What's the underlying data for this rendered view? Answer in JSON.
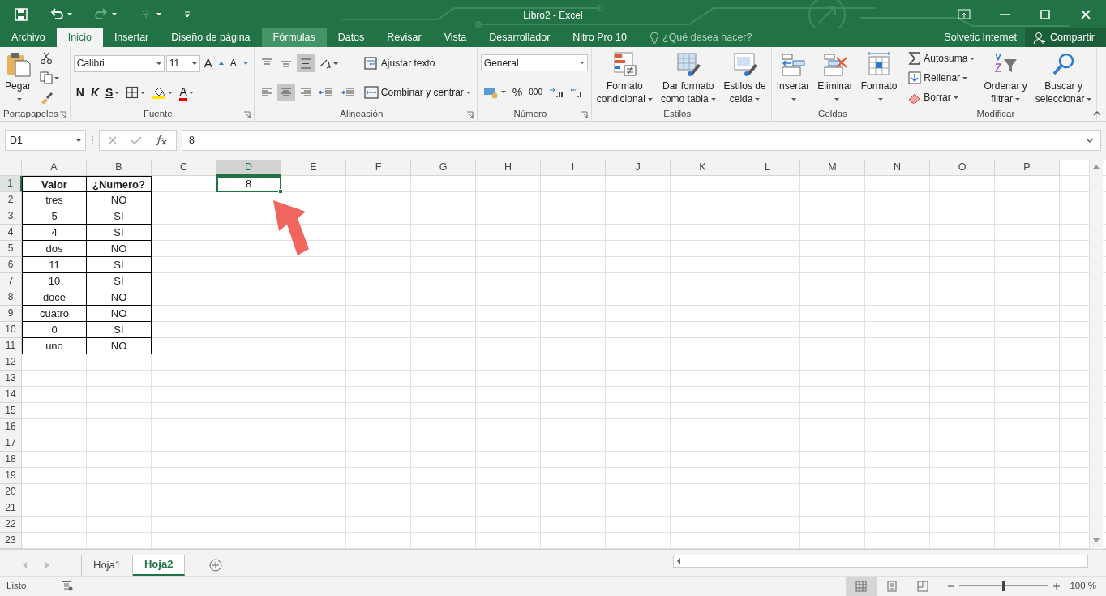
{
  "window": {
    "title": "Libro2 - Excel"
  },
  "tabs": [
    {
      "label": "Archivo",
      "selected": false,
      "highlighted": false
    },
    {
      "label": "Inicio",
      "selected": true,
      "highlighted": false
    },
    {
      "label": "Insertar",
      "selected": false,
      "highlighted": false
    },
    {
      "label": "Diseño de página",
      "selected": false,
      "highlighted": false
    },
    {
      "label": "Fórmulas",
      "selected": false,
      "highlighted": true
    },
    {
      "label": "Datos",
      "selected": false,
      "highlighted": false
    },
    {
      "label": "Revisar",
      "selected": false,
      "highlighted": false
    },
    {
      "label": "Vista",
      "selected": false,
      "highlighted": false
    },
    {
      "label": "Desarrollador",
      "selected": false,
      "highlighted": false
    },
    {
      "label": "Nitro Pro 10",
      "selected": false,
      "highlighted": false
    }
  ],
  "tell_me": {
    "placeholder": "¿Qué desea hacer?"
  },
  "account": {
    "user": "Solvetic Internet",
    "share": "Compartir"
  },
  "ribbon": [
    {
      "label": "Portapapeles",
      "launcher": true,
      "columns": [
        [
          [
            {
              "kind": "large",
              "lines": [
                "Pegar"
              ],
              "dropdown": true
            }
          ]
        ],
        [
          [
            {
              "kind": "icon",
              "dropdown": false
            }
          ],
          [
            {
              "kind": "icon",
              "dropdown": true
            }
          ],
          [
            {
              "kind": "icon",
              "dropdown": false
            }
          ]
        ]
      ]
    },
    {
      "label": "Fuente",
      "launcher": true,
      "columns": [
        [
          [
            {
              "kind": "field",
              "value": "Calibri"
            },
            {
              "kind": "field",
              "value": "11"
            },
            {
              "kind": "grow",
              "label": "A",
              "dropdown": false
            },
            {
              "kind": "shrink",
              "label": "A",
              "dropdown": false
            }
          ],
          [
            {
              "kind": "bold",
              "label": "N",
              "dropdown": false
            },
            {
              "kind": "italic",
              "label": "K",
              "dropdown": false
            },
            {
              "kind": "underline",
              "label": "S",
              "dropdown": true
            },
            {
              "kind": "icon",
              "dropdown": true
            },
            {
              "kind": "icon",
              "dropdown": true
            },
            {
              "kind": "color",
              "label": "A",
              "dropdown": true
            }
          ]
        ]
      ]
    },
    {
      "label": "Alineación",
      "launcher": true,
      "columns": [
        [
          [
            {
              "kind": "icon",
              "dropdown": false,
              "pressed": false
            },
            {
              "kind": "icon",
              "dropdown": false,
              "pressed": false
            },
            {
              "kind": "icon",
              "dropdown": false,
              "pressed": true
            },
            {
              "kind": "icon",
              "dropdown": true,
              "pressed": false
            }
          ],
          [
            {
              "kind": "icon",
              "dropdown": false,
              "pressed": false
            },
            {
              "kind": "icon",
              "dropdown": false,
              "pressed": true
            },
            {
              "kind": "icon",
              "dropdown": false,
              "pressed": false
            },
            {
              "kind": "icon",
              "dropdown": false,
              "pressed": false
            },
            {
              "kind": "icon",
              "dropdown": false,
              "pressed": false
            }
          ]
        ],
        [
          [
            {
              "kind": "small",
              "label": "Ajustar texto",
              "dropdown": false
            }
          ],
          [
            {
              "kind": "small",
              "label": "Combinar y centrar",
              "dropdown": true
            }
          ]
        ]
      ]
    },
    {
      "label": "Número",
      "launcher": true,
      "columns": [
        [
          [
            {
              "kind": "field",
              "value": "General"
            }
          ],
          [
            {
              "kind": "icon",
              "dropdown": true
            },
            {
              "kind": "glyph",
              "label": "%",
              "dropdown": false
            },
            {
              "kind": "small-glyph",
              "label": "000",
              "dropdown": false
            },
            {
              "kind": "icon",
              "dropdown": false
            },
            {
              "kind": "icon",
              "dropdown": false
            }
          ]
        ]
      ]
    },
    {
      "label": "Estilos",
      "launcher": false,
      "columns": [
        [
          [
            {
              "kind": "large",
              "lines": [
                "Formato",
                "condicional"
              ],
              "dropdown": true
            }
          ]
        ],
        [
          [
            {
              "kind": "large",
              "lines": [
                "Dar formato",
                "como tabla"
              ],
              "dropdown": true
            }
          ]
        ],
        [
          [
            {
              "kind": "large",
              "lines": [
                "Estilos de",
                "celda"
              ],
              "dropdown": true
            }
          ]
        ]
      ]
    },
    {
      "label": "Celdas",
      "launcher": false,
      "columns": [
        [
          [
            {
              "kind": "large",
              "lines": [
                "Insertar"
              ],
              "dropdown": true
            }
          ]
        ],
        [
          [
            {
              "kind": "large",
              "lines": [
                "Eliminar"
              ],
              "dropdown": true
            }
          ]
        ],
        [
          [
            {
              "kind": "large",
              "lines": [
                "Formato"
              ],
              "dropdown": true
            }
          ]
        ]
      ]
    },
    {
      "label": "Modificar",
      "launcher": false,
      "columns": [
        [
          [
            {
              "kind": "small",
              "label": "Autosuma",
              "dropdown": true
            }
          ],
          [
            {
              "kind": "small",
              "label": "Rellenar",
              "dropdown": true
            }
          ],
          [
            {
              "kind": "small",
              "label": "Borrar",
              "dropdown": true
            }
          ]
        ],
        [
          [
            {
              "kind": "large",
              "lines": [
                "Ordenar y",
                "filtrar"
              ],
              "dropdown": true
            }
          ]
        ],
        [
          [
            {
              "kind": "large",
              "lines": [
                "Buscar y",
                "seleccionar"
              ],
              "dropdown": true
            }
          ]
        ]
      ]
    }
  ],
  "formula_bar": {
    "name_box": "D1",
    "value": "8"
  },
  "active_cell": {
    "value": "8"
  },
  "columns": [
    {
      "label": "A",
      "selected": false
    },
    {
      "label": "B",
      "selected": false
    },
    {
      "label": "C",
      "selected": false
    },
    {
      "label": "D",
      "selected": true
    },
    {
      "label": "E",
      "selected": false
    },
    {
      "label": "F",
      "selected": false
    },
    {
      "label": "G",
      "selected": false
    },
    {
      "label": "H",
      "selected": false
    },
    {
      "label": "I",
      "selected": false
    },
    {
      "label": "J",
      "selected": false
    },
    {
      "label": "K",
      "selected": false
    },
    {
      "label": "L",
      "selected": false
    },
    {
      "label": "M",
      "selected": false
    },
    {
      "label": "N",
      "selected": false
    },
    {
      "label": "O",
      "selected": false
    },
    {
      "label": "P",
      "selected": false
    }
  ],
  "rows": [
    {
      "label": "1",
      "selected": true,
      "cells": [
        {
          "text": "Valor",
          "bold": true
        },
        {
          "text": "¿Numero?",
          "bold": true
        }
      ]
    },
    {
      "label": "2",
      "selected": false,
      "cells": [
        {
          "text": "tres",
          "bold": false
        },
        {
          "text": "NO",
          "bold": false
        }
      ]
    },
    {
      "label": "3",
      "selected": false,
      "cells": [
        {
          "text": "5",
          "bold": false
        },
        {
          "text": "SI",
          "bold": false
        }
      ]
    },
    {
      "label": "4",
      "selected": false,
      "cells": [
        {
          "text": "4",
          "bold": false
        },
        {
          "text": "SI",
          "bold": false
        }
      ]
    },
    {
      "label": "5",
      "selected": false,
      "cells": [
        {
          "text": "dos",
          "bold": false
        },
        {
          "text": "NO",
          "bold": false
        }
      ]
    },
    {
      "label": "6",
      "selected": false,
      "cells": [
        {
          "text": "11",
          "bold": false
        },
        {
          "text": "SI",
          "bold": false
        }
      ]
    },
    {
      "label": "7",
      "selected": false,
      "cells": [
        {
          "text": "10",
          "bold": false
        },
        {
          "text": "SI",
          "bold": false
        }
      ]
    },
    {
      "label": "8",
      "selected": false,
      "cells": [
        {
          "text": "doce",
          "bold": false
        },
        {
          "text": "NO",
          "bold": false
        }
      ]
    },
    {
      "label": "9",
      "selected": false,
      "cells": [
        {
          "text": "cuatro",
          "bold": false
        },
        {
          "text": "NO",
          "bold": false
        }
      ]
    },
    {
      "label": "10",
      "selected": false,
      "cells": [
        {
          "text": "0",
          "bold": false
        },
        {
          "text": "SI",
          "bold": false
        }
      ]
    },
    {
      "label": "11",
      "selected": false,
      "cells": [
        {
          "text": "uno",
          "bold": false
        },
        {
          "text": "NO",
          "bold": false
        }
      ]
    },
    {
      "label": "12",
      "selected": false
    },
    {
      "label": "13",
      "selected": false
    },
    {
      "label": "14",
      "selected": false
    },
    {
      "label": "15",
      "selected": false
    },
    {
      "label": "16",
      "selected": false
    },
    {
      "label": "17",
      "selected": false
    },
    {
      "label": "18",
      "selected": false
    },
    {
      "label": "19",
      "selected": false
    },
    {
      "label": "20",
      "selected": false
    },
    {
      "label": "21",
      "selected": false
    },
    {
      "label": "22",
      "selected": false
    },
    {
      "label": "23",
      "selected": false
    }
  ],
  "sheets": [
    {
      "label": "Hoja1",
      "selected": false
    },
    {
      "label": "Hoja2",
      "selected": true
    }
  ],
  "status": {
    "text": "Listo",
    "zoom": "100 %"
  },
  "views": [
    {
      "selected": true
    },
    {
      "selected": false
    },
    {
      "selected": false
    }
  ],
  "zoom_slider": {
    "level": 0.5
  }
}
